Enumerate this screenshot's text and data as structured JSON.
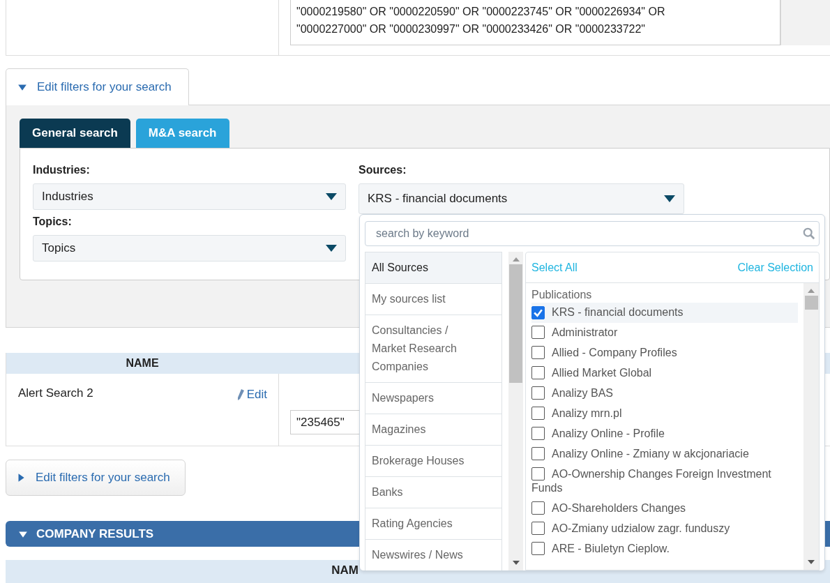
{
  "query_box": {
    "lines": [
      "\"0000219580\" OR \"0000220590\" OR \"0000223745\" OR \"0000226934\" OR",
      "\"0000227000\" OR \"0000230997\" OR \"0000233426\" OR \"0000233722\""
    ]
  },
  "filter_toggle_top": {
    "label": "Edit filters for your search",
    "expanded": true
  },
  "filter_panel": {
    "tabs": [
      {
        "label": "General search",
        "selected": true
      },
      {
        "label": "M&A search",
        "selected": false
      }
    ],
    "industries": {
      "label": "Industries:",
      "value": "Industries"
    },
    "topics": {
      "label": "Topics:",
      "value": "Topics"
    },
    "sources": {
      "label": "Sources:",
      "value": "KRS - financial documents"
    }
  },
  "sources_popup": {
    "search_placeholder": "search by keyword",
    "categories": [
      {
        "label": "All Sources",
        "selected": true
      },
      {
        "label": "My sources list",
        "selected": false
      },
      {
        "label": "Consultancies / Market Research Companies",
        "selected": false
      },
      {
        "label": "Newspapers",
        "selected": false
      },
      {
        "label": "Magazines",
        "selected": false
      },
      {
        "label": "Brokerage Houses",
        "selected": false
      },
      {
        "label": "Banks",
        "selected": false
      },
      {
        "label": "Rating Agencies",
        "selected": false
      },
      {
        "label": "Newswires / News",
        "selected": false
      }
    ],
    "select_all": "Select All",
    "clear_selection": "Clear Selection",
    "group": "Publications",
    "items": [
      {
        "label": "KRS - financial documents",
        "checked": true
      },
      {
        "label": "Administrator",
        "checked": false
      },
      {
        "label": "Allied - Company Profiles",
        "checked": false
      },
      {
        "label": "Allied Market Global",
        "checked": false
      },
      {
        "label": "Analizy BAS",
        "checked": false
      },
      {
        "label": "Analizy mrn.pl",
        "checked": false
      },
      {
        "label": "Analizy Online - Profile",
        "checked": false
      },
      {
        "label": "Analizy Online - Zmiany w akcjonariacie",
        "checked": false
      },
      {
        "label": "AO-Ownership Changes Foreign Investment Funds",
        "checked": false
      },
      {
        "label": "AO-Shareholders Changes",
        "checked": false
      },
      {
        "label": "AO-Zmiany udzialow zagr. funduszy",
        "checked": false
      },
      {
        "label": "ARE - Biuletyn Cieplow.",
        "checked": false
      }
    ]
  },
  "alerts_table": {
    "header": "NAME",
    "row": {
      "name": "Alert Search 2",
      "edit": "Edit",
      "query": "\"235465\""
    }
  },
  "filter_toggle_bottom": {
    "label": "Edit filters for your search",
    "expanded": false
  },
  "company_results": {
    "title": "COMPANY RESULTS",
    "expanded": true,
    "header": "NAM"
  }
}
